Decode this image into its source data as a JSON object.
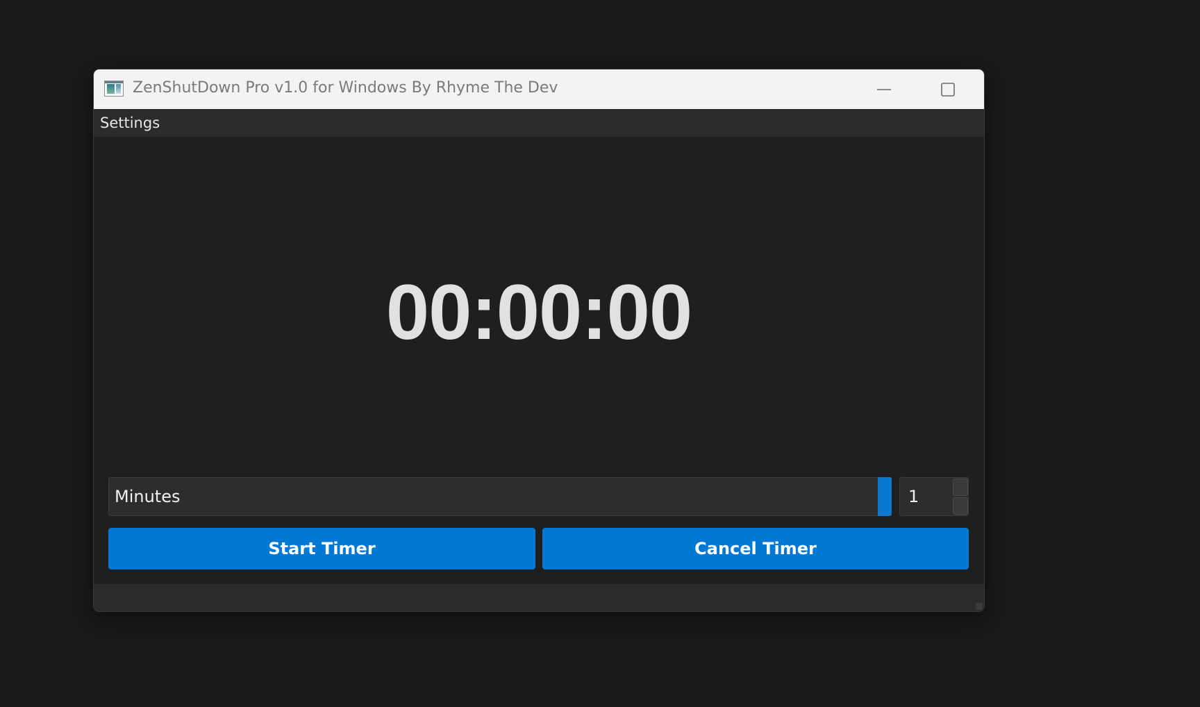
{
  "window": {
    "title": "ZenShutDown Pro v1.0 for Windows By Rhyme The Dev",
    "app_icon": "app-window-icon",
    "controls": {
      "minimize_icon": "minimize-icon",
      "maximize_icon": "maximize-icon",
      "close_icon": "close-icon"
    }
  },
  "menu": {
    "items": [
      {
        "label": "Settings"
      }
    ]
  },
  "timer": {
    "display": "00:00:00"
  },
  "controls": {
    "unit_select": {
      "value": "Minutes"
    },
    "amount_spinbox": {
      "value": "1"
    },
    "start_button": {
      "label": "Start Timer"
    },
    "cancel_button": {
      "label": "Cancel Timer"
    }
  },
  "colors": {
    "accent": "#0078d4",
    "background": "#1f1f1f",
    "titlebar": "#f3f3f3",
    "timer_text": "#e1e1e1"
  }
}
